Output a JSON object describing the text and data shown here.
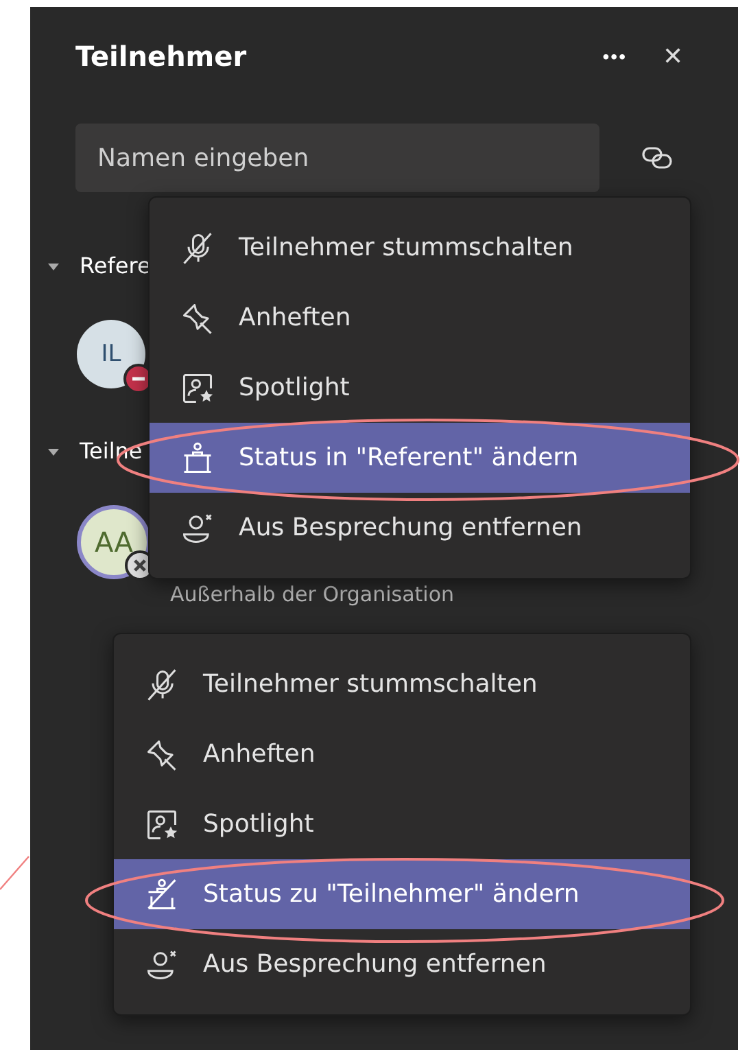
{
  "panel": {
    "title": "Teilnehmer",
    "more_label": "•••",
    "close_label": "✕"
  },
  "search": {
    "placeholder": "Namen eingeben"
  },
  "sections": [
    {
      "label": "Refere",
      "expanded": true,
      "people": [
        {
          "initials": "IL",
          "kind": "busy",
          "ring": false
        }
      ]
    },
    {
      "label": "Teilne",
      "expanded": true,
      "people": [
        {
          "initials": "AA",
          "kind": "external",
          "ring": true,
          "subtitle": "Außerhalb der Organisation"
        }
      ]
    }
  ],
  "menus": [
    {
      "items": [
        {
          "kind": "mute",
          "label": "Teilnehmer stummschalten",
          "selected": false
        },
        {
          "kind": "pin",
          "label": "Anheften",
          "selected": false
        },
        {
          "kind": "spotlight",
          "label": "Spotlight",
          "selected": false
        },
        {
          "kind": "presenter",
          "label": "Status in \"Referent\" ändern",
          "selected": true
        },
        {
          "kind": "remove",
          "label": "Aus Besprechung entfernen",
          "selected": false
        }
      ]
    },
    {
      "items": [
        {
          "kind": "mute",
          "label": "Teilnehmer stummschalten",
          "selected": false
        },
        {
          "kind": "pin",
          "label": "Anheften",
          "selected": false
        },
        {
          "kind": "spotlight",
          "label": "Spotlight",
          "selected": false
        },
        {
          "kind": "attendee",
          "label": "Status zu \"Teilnehmer\" ändern",
          "selected": true
        },
        {
          "kind": "remove",
          "label": "Aus Besprechung entfernen",
          "selected": false
        }
      ]
    }
  ],
  "annotations": [
    {
      "kind": "ellipse"
    },
    {
      "kind": "ellipse"
    },
    {
      "kind": "line"
    }
  ]
}
